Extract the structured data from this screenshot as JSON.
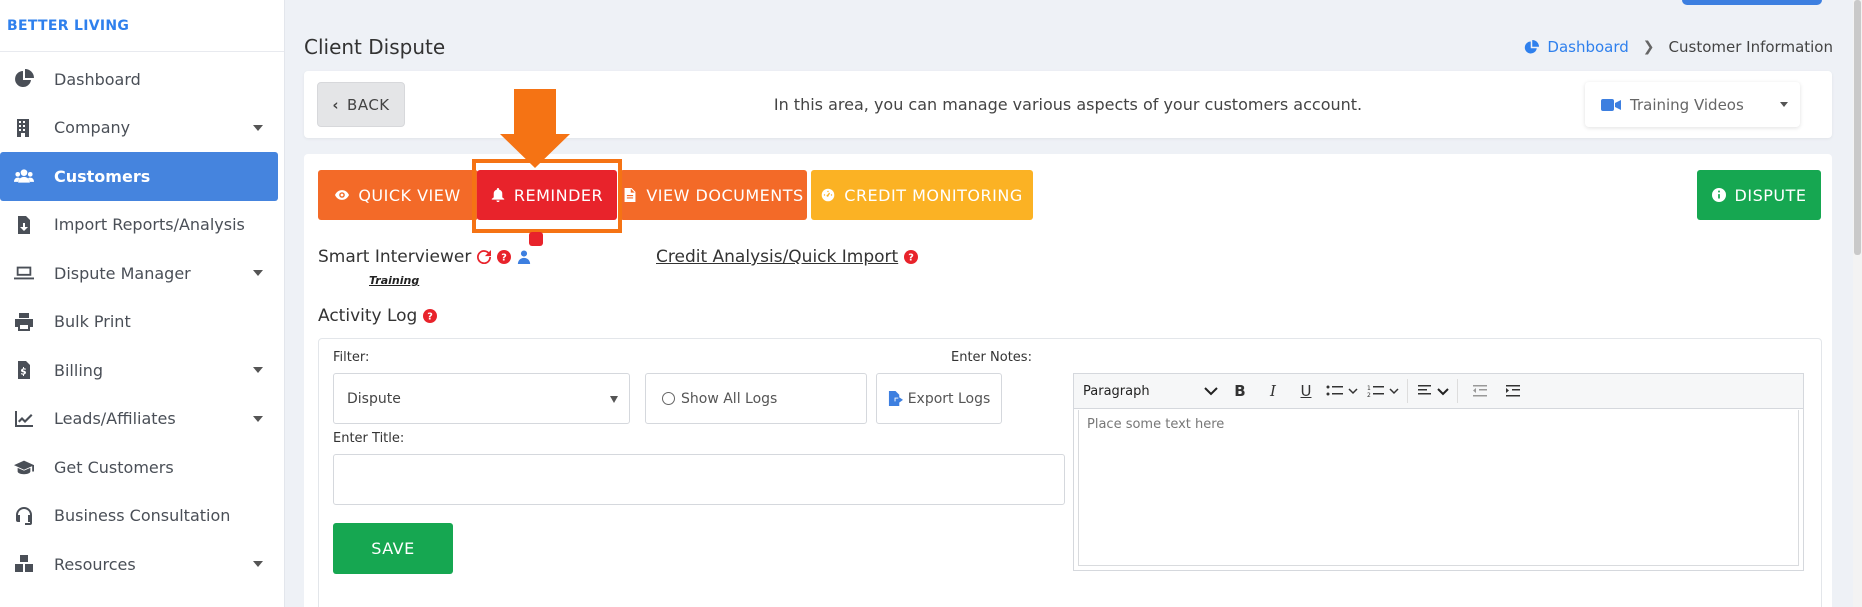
{
  "brand": "BETTER LIVING",
  "sidebar": {
    "items": [
      {
        "label": "Dashboard",
        "icon": "pie-chart-icon"
      },
      {
        "label": "Company",
        "icon": "building-icon",
        "has_submenu": true
      },
      {
        "label": "Customers",
        "icon": "users-icon",
        "active": true
      },
      {
        "label": "Import Reports/Analysis",
        "icon": "file-import-icon"
      },
      {
        "label": "Dispute Manager",
        "icon": "laptop-icon",
        "has_submenu": true
      },
      {
        "label": "Bulk Print",
        "icon": "printer-icon"
      },
      {
        "label": "Billing",
        "icon": "invoice-icon",
        "has_submenu": true
      },
      {
        "label": "Leads/Affiliates",
        "icon": "chart-line-icon",
        "has_submenu": true
      },
      {
        "label": "Get Customers",
        "icon": "graduation-cap-icon"
      },
      {
        "label": "Business Consultation",
        "icon": "headset-icon"
      },
      {
        "label": "Resources",
        "icon": "boxes-icon",
        "has_submenu": true
      }
    ]
  },
  "header": {
    "title": "Client Dispute",
    "breadcrumb": {
      "home": "Dashboard",
      "current": "Customer Information"
    }
  },
  "info_bar": {
    "back_label": "BACK",
    "message": "In this area, you can manage various aspects of your customers account.",
    "training_select": "Training Videos"
  },
  "actions": {
    "quick_view": "QUICK VIEW",
    "reminder": "REMINDER",
    "view_documents": "VIEW DOCUMENTS",
    "credit_monitoring": "CREDIT MONITORING",
    "dispute": "DISPUTE"
  },
  "smart_interviewer": {
    "label": "Smart Interviewer",
    "training": "Training"
  },
  "credit_analysis": "Credit Analysis/Quick Import",
  "activity_log": {
    "title": "Activity Log",
    "filter_label": "Filter:",
    "filter_value": "Dispute",
    "show_all": "Show All Logs",
    "export": "Export Logs",
    "title_label": "Enter Title:",
    "save": "SAVE",
    "notes_label": "Enter Notes:",
    "editor": {
      "paragraph": "Paragraph",
      "placeholder": "Place some text here"
    }
  },
  "colors": {
    "orange": "#f36a28",
    "red": "#e8232b",
    "yellow": "#fbb224",
    "green": "#16a751",
    "blue": "#4584de",
    "highlight": "#f57314"
  }
}
